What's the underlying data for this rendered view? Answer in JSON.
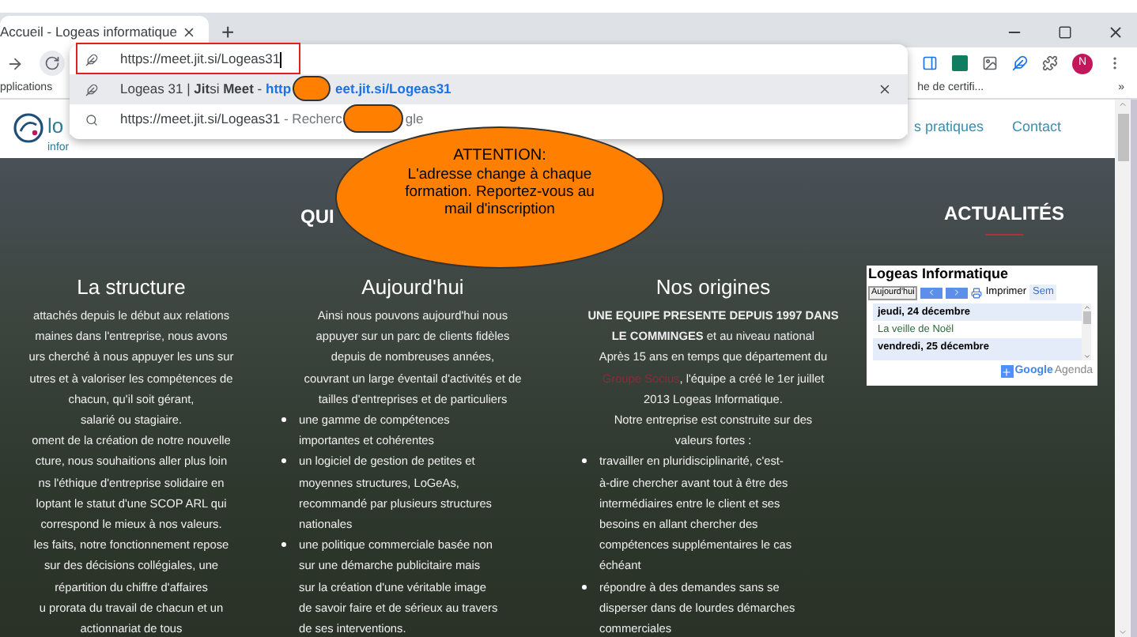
{
  "browser": {
    "tabs": [
      {
        "title": "Accueil - Logeas informatique",
        "selected": true
      }
    ],
    "new_tab": "+",
    "omnibox": {
      "value": "https://meet.jit.si/Logeas31"
    },
    "suggestions": [
      {
        "kind": "site",
        "text": "Logeas 31 | **Jit**si **Meet** - ",
        "link_start": "http",
        "link_end": "eet.jit.si/Logeas31",
        "selected": true
      },
      {
        "kind": "search",
        "text": "https://meet.jit.si/Logeas31",
        "suffix_start": " - Recherc",
        "suffix_end": "gle",
        "selected": false
      }
    ],
    "profile": "N",
    "bookmarks": [
      "pplications",
      "he de certifi...",
      "»"
    ]
  },
  "site": {
    "logo": {
      "name": "lo",
      "sub": "infor"
    },
    "nav": [
      "s pratiques",
      "Contact"
    ],
    "section_title": "QUI",
    "news_title": "ACTUALITÉS",
    "columns": [
      {
        "title": "La structure",
        "lines": [
          {
            "kind": "line",
            "text": "attachés depuis le début aux relations"
          },
          {
            "kind": "line",
            "text": "maines dans l'entreprise, nous avons"
          },
          {
            "kind": "line",
            "text": "urs cherché à nous appuyer les uns sur"
          },
          {
            "kind": "line",
            "text": "utres et à valoriser les compétences de"
          },
          {
            "kind": "line",
            "text": "chacun, qu'il soit gérant,"
          },
          {
            "kind": "line",
            "text": "salarié ou stagiaire."
          },
          {
            "kind": "line",
            "text": "oment de la création de notre nouvelle"
          },
          {
            "kind": "line",
            "text": "cture, nous souhaitions aller plus loin"
          },
          {
            "kind": "line",
            "text": "ns l'éthique d'entreprise solidaire en"
          },
          {
            "kind": "line",
            "text": "loptant le statut d'une SCOP ARL qui"
          },
          {
            "kind": "line",
            "text": "correspond le mieux à nos valeurs."
          },
          {
            "kind": "line",
            "text": "les faits, notre fonctionnement repose"
          },
          {
            "kind": "line",
            "text": "sur des décisions collégiales, une"
          },
          {
            "kind": "line",
            "text": "répartition du chiffre d'affaires"
          },
          {
            "kind": "line",
            "text": "u prorata du travail de chacun et un"
          },
          {
            "kind": "line",
            "text": "actionnariat de tous"
          }
        ]
      },
      {
        "title": "Aujourd'hui",
        "lines": [
          {
            "kind": "line",
            "text": "Ainsi nous pouvons aujourd'hui nous"
          },
          {
            "kind": "line",
            "text": "appuyer sur un parc de clients fidèles"
          },
          {
            "kind": "line",
            "text": "depuis de nombreuses années,"
          },
          {
            "kind": "line",
            "text": "couvrant un large éventail d'activités et de"
          },
          {
            "kind": "line",
            "text": "tailles d'entreprises et de particuliers"
          },
          {
            "kind": "bullet",
            "lines": [
              "une gamme de compétences",
              "importantes et cohérentes"
            ]
          },
          {
            "kind": "bullet",
            "lines": [
              "un logiciel de gestion de petites et",
              "moyennes structures, LoGeAs,",
              "recommandé par plusieurs structures",
              "nationales"
            ]
          },
          {
            "kind": "bullet",
            "lines": [
              "une politique commerciale basée non",
              "sur une démarche publicitaire mais",
              "sur la création d'une véritable image",
              "de savoir faire et de sérieux au travers",
              "de ses interventions."
            ]
          }
        ]
      },
      {
        "title": "Nos origines",
        "lines": [
          {
            "kind": "line",
            "text": "**UNE EQUIPE PRESENTE DEPUIS 1997 DANS**"
          },
          {
            "kind": "line",
            "text": "**LE COMMINGES** et au niveau national"
          },
          {
            "kind": "line",
            "text": "Après 15 ans en temps que département du"
          },
          {
            "kind": "link_line",
            "link": "Groupe Socius",
            "text": ", l'équipe a créé le 1er juillet"
          },
          {
            "kind": "line",
            "text": "2013 Logeas Informatique."
          },
          {
            "kind": "line",
            "text": "Notre entreprise est construite sur des"
          },
          {
            "kind": "line",
            "text": "valeurs fortes :"
          },
          {
            "kind": "bullet",
            "lines": [
              "travailler en pluridisciplinarité, c'est-",
              "à-dire chercher avant tout à être des",
              "intermédiaires entre le client et ses",
              "besoins en allant chercher des",
              "compétences supplémentaires le cas",
              "échéant"
            ]
          },
          {
            "kind": "bullet",
            "lines": [
              "répondre à des demandes sans se",
              "disperser dans de lourdes démarches",
              "commerciales"
            ]
          }
        ]
      }
    ],
    "calendar": {
      "title": "Logeas Informatique",
      "today": "Aujourd'hui",
      "print": "Imprimer",
      "view_tab": "Sem",
      "entries": [
        {
          "kind": "date",
          "text": "jeudi, 24 décembre"
        },
        {
          "kind": "event",
          "text": "La veille de Noël"
        },
        {
          "kind": "date",
          "text": "vendredi, 25 décembre"
        }
      ],
      "footer_brand": "Google",
      "footer_label": "Agenda"
    }
  },
  "callout": {
    "title": "ATTENTION:",
    "text": "L'adresse change à chaque\nformation. Reportez-vous au\nmail d'inscription"
  }
}
